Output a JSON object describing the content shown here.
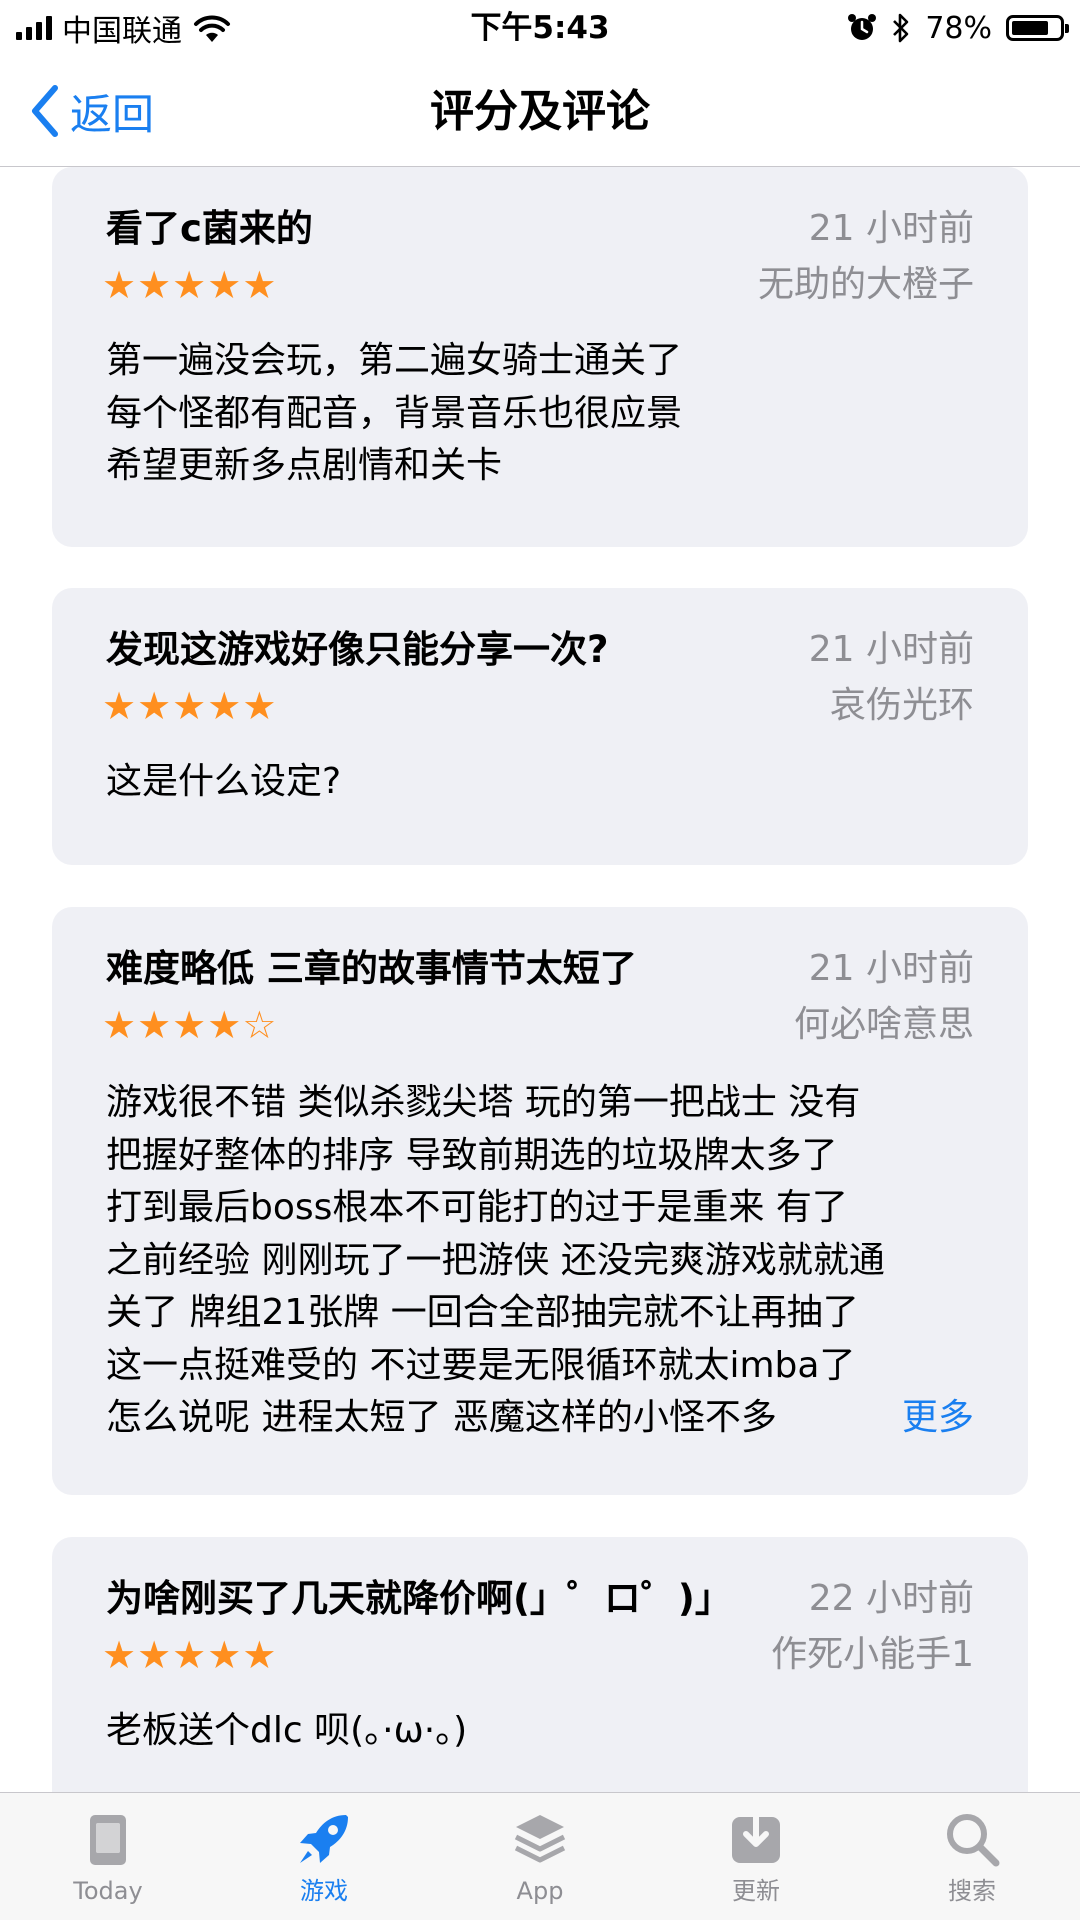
{
  "status_bar": {
    "carrier": "中国联通",
    "time": "下午5:43",
    "battery_percent": "78%",
    "battery_level": 0.78
  },
  "nav": {
    "back_label": "返回",
    "title": "评分及评论"
  },
  "reviews": [
    {
      "title": "看了c菌来的",
      "rating": 5,
      "date": "21 小时前",
      "author": "无助的大橙子",
      "body": [
        "第一遍没会玩，第二遍女骑士通关了",
        "每个怪都有配音，背景音乐也很应景",
        "希望更新多点剧情和关卡"
      ]
    },
    {
      "title": "发现这游戏好像只能分享一次?",
      "rating": 5,
      "date": "21 小时前",
      "author": "哀伤光环",
      "body": [
        "这是什么设定?"
      ]
    },
    {
      "title": "难度略低  三章的故事情节太短了",
      "rating": 4,
      "date": "21 小时前",
      "author": "何必啥意思",
      "body": [
        "游戏很不错 类似杀戮尖塔 玩的第一把战士  没有",
        "把握好整体的排序  导致前期选的垃圾牌太多了",
        "打到最后boss根本不可能打的过于是重来  有了",
        "之前经验 刚刚玩了一把游侠 还没完爽游戏就就通",
        "关了   牌组21张牌 一回合全部抽完就不让再抽了",
        "这一点挺难受的  不过要是无限循环就太imba了"
      ],
      "truncated_line": "怎么说呢  进程太短了  恶魔这样的小怪不多",
      "more_label": "更多"
    },
    {
      "title": "为啥刚买了几天就降价啊(」゜ロ゜)」",
      "rating": 5,
      "date": "22 小时前",
      "author": "作死小能手1",
      "body": [
        "老板送个dlc 呗(。·ω·。)"
      ]
    }
  ],
  "tab_bar": {
    "tabs": [
      {
        "label": "Today",
        "icon": "today-icon",
        "active": false
      },
      {
        "label": "游戏",
        "icon": "rocket-icon",
        "active": true
      },
      {
        "label": "App",
        "icon": "app-stack-icon",
        "active": false
      },
      {
        "label": "更新",
        "icon": "updates-icon",
        "active": false
      },
      {
        "label": "搜索",
        "icon": "search-icon",
        "active": false
      }
    ]
  },
  "colors": {
    "accent": "#1a7ff0",
    "star": "#ff8f1f",
    "card_bg": "#eff0f5",
    "secondary_text": "#8e8e93"
  }
}
